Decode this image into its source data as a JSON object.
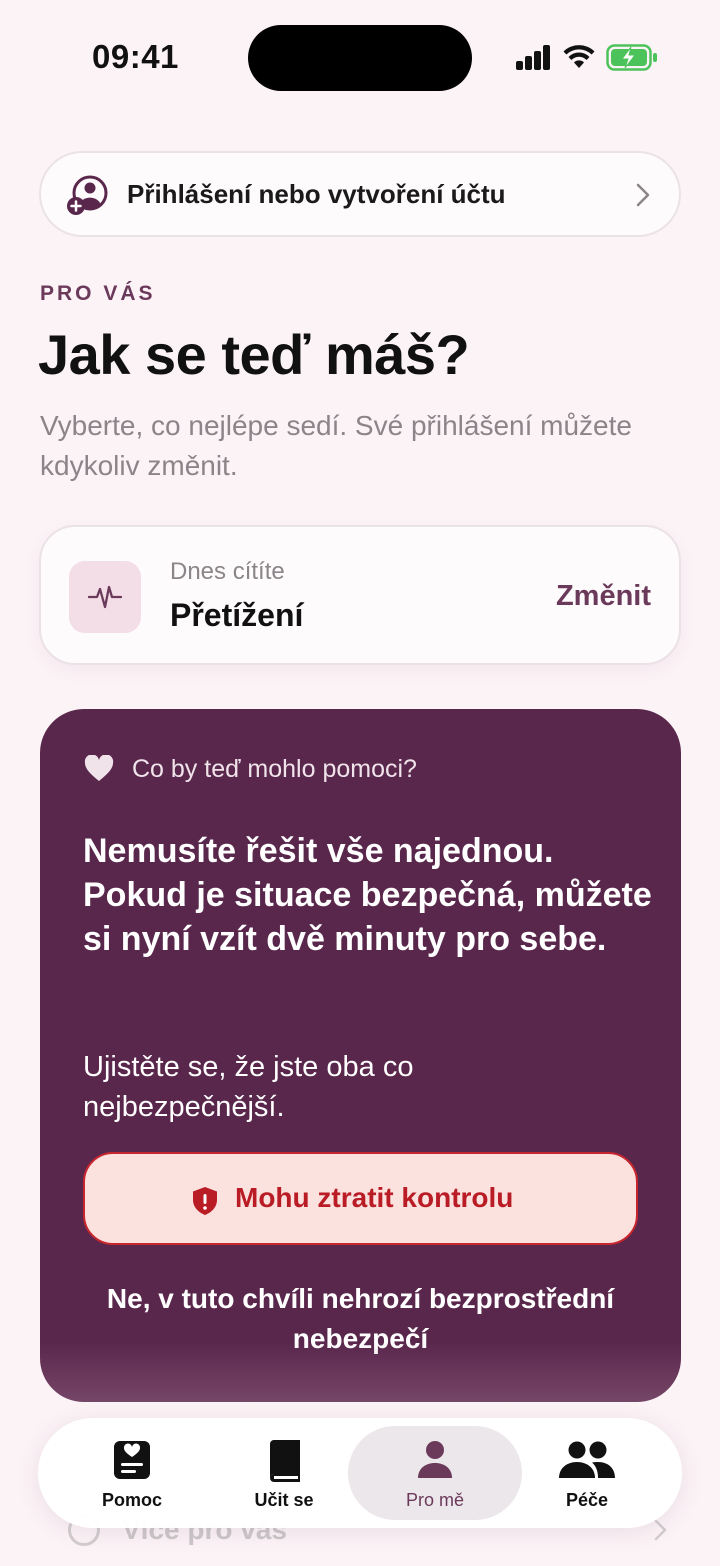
{
  "status_bar": {
    "time": "09:41"
  },
  "login": {
    "label": "Přihlášení nebo vytvoření účtu"
  },
  "header": {
    "eyebrow": "PRO VÁS",
    "title": "Jak se teď máš?",
    "subtitle": "Vyberte, co nejlépe sedí. Své přihlášení můžete kdykoliv změnit."
  },
  "feeling": {
    "caption": "Dnes cítíte",
    "value": "Přetížení",
    "change_label": "Změnit"
  },
  "help_card": {
    "heading": "Co by teď mohlo pomoci?",
    "main_text": "Nemusíte řešit vše najednou. Pokud je situace bezpečná, můžete si nyní vzít dvě minuty pro sebe.",
    "secondary_text": "Ujistěte se, že jste oba co nejbezpečnější.",
    "danger_button_label": "Mohu ztratit kontrolu",
    "safe_link_label": "Ne, v tuto chvíli nehrozí bezprostřední nebezpečí"
  },
  "more_row": {
    "label": "Více pro vás"
  },
  "tab_bar": {
    "tabs": [
      {
        "label": "Pomoc",
        "icon": "heart-card-icon"
      },
      {
        "label": "Učit se",
        "icon": "book-icon"
      },
      {
        "label": "Pro mě",
        "icon": "person-icon",
        "active": true
      },
      {
        "label": "Péče",
        "icon": "people-icon"
      }
    ]
  },
  "colors": {
    "background": "#fcf3f7",
    "accent": "#6b3a5a",
    "card_dark": "#5a274c",
    "danger": "#b91c25",
    "danger_bg": "#fbe2de"
  }
}
